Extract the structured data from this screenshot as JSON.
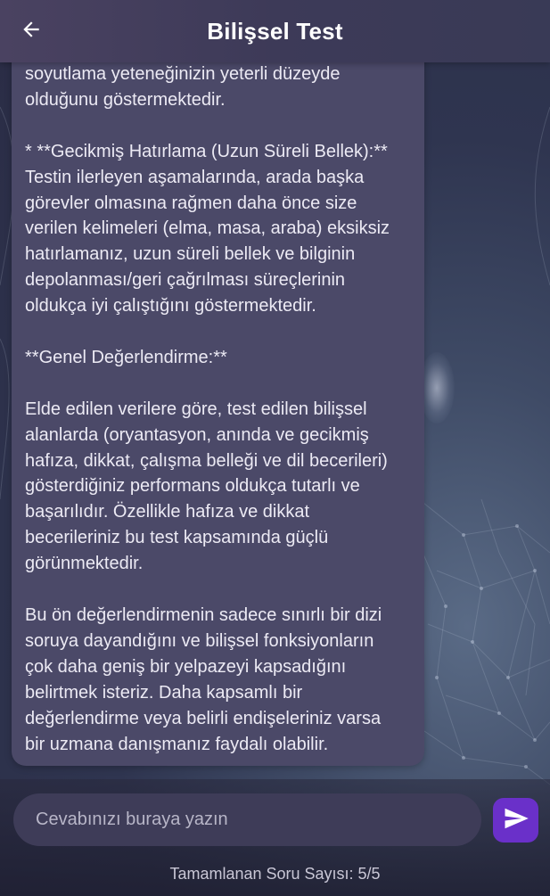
{
  "header": {
    "title": "Bilişsel Test",
    "back_icon": "arrow-left-icon"
  },
  "message": {
    "lines": [
      "soyutlama yeteneğinizin yeterli düzeyde",
      "olduğunu göstermektedir.",
      "",
      "*   **Gecikmiş Hatırlama (Uzun Süreli Bellek):**",
      "Testin ilerleyen aşamalarında, arada başka",
      "görevler olmasına rağmen daha önce size",
      "verilen kelimeleri (elma, masa, araba) eksiksiz",
      "hatırlamanız, uzun süreli bellek ve bilginin",
      "depolanması/geri çağrılması süreçlerinin",
      "oldukça iyi çalıştığını göstermektedir.",
      "",
      "**Genel Değerlendirme:**",
      "",
      "Elde edilen verilere göre, test edilen bilişsel",
      "alanlarda (oryantasyon, anında ve gecikmiş",
      "hafıza, dikkat, çalışma belleği ve dil becerileri)",
      "gösterdiğiniz performans oldukça tutarlı ve",
      "başarılıdır. Özellikle hafıza ve dikkat",
      "becerileriniz bu test kapsamında güçlü",
      "görünmektedir.",
      "",
      "Bu ön değerlendirmenin sadece sınırlı bir dizi",
      "soruya dayandığını ve bilişsel fonksiyonların",
      "çok daha geniş bir yelpazeyi kapsadığını",
      "belirtmek isteriz. Daha kapsamlı bir",
      "değerlendirme veya belirli endişeleriniz varsa",
      "bir uzmana danışmanız faydalı olabilir."
    ]
  },
  "composer": {
    "placeholder": "Cevabınızı buraya yazın",
    "value": "",
    "send_icon": "send-icon",
    "accent_color": "#6a30c9"
  },
  "footer": {
    "progress_text": "Tamamlanan Soru Sayısı: 5/5"
  }
}
